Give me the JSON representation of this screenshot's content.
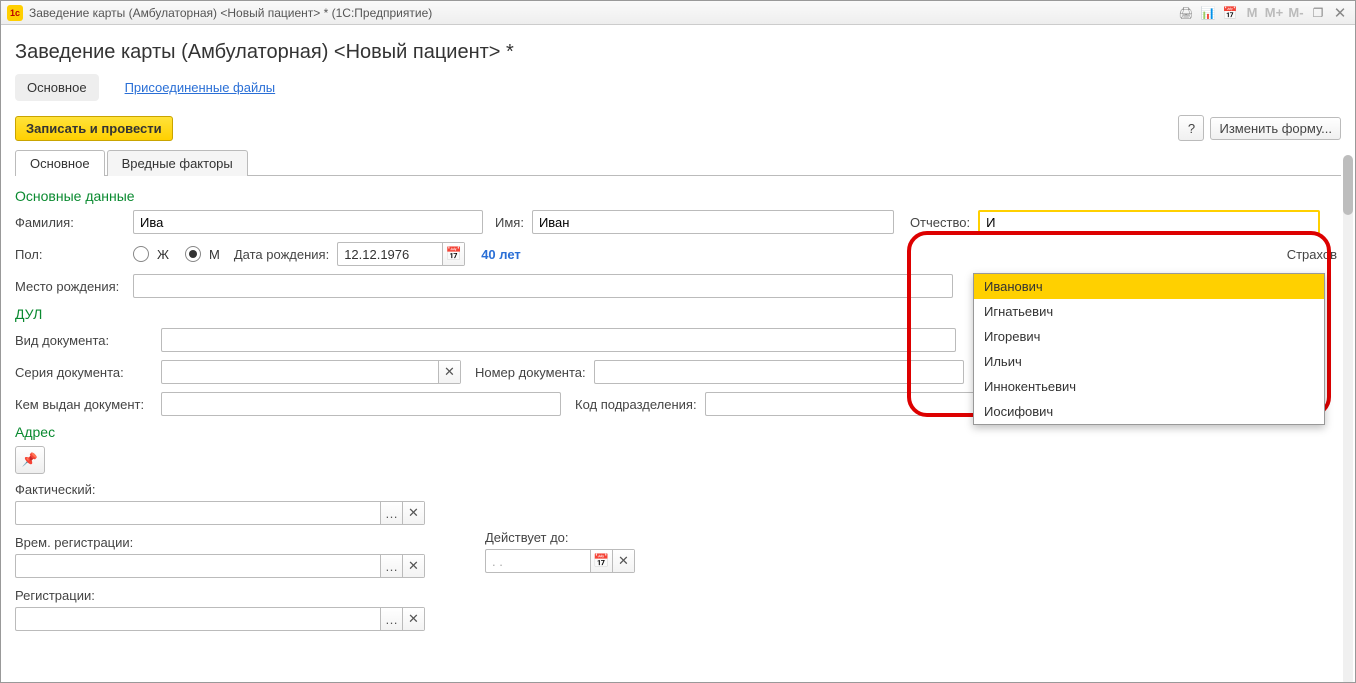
{
  "window_title": "Заведение карты (Амбулаторная) <Новый пациент> *  (1С:Предприятие)",
  "page_header": "Заведение карты (Амбулаторная) <Новый пациент> *",
  "nav": {
    "main": "Основное",
    "files": "Присоединенные файлы"
  },
  "toolbar": {
    "save": "Записать и провести",
    "help": "?",
    "change_form": "Изменить форму..."
  },
  "tabs": {
    "main": "Основное",
    "harmful": "Вредные факторы"
  },
  "sections": {
    "basic": "Основные данные",
    "dul": "ДУЛ",
    "address": "Адрес"
  },
  "labels": {
    "surname": "Фамилия:",
    "name": "Имя:",
    "patronymic": "Отчество:",
    "sex": "Пол:",
    "sex_f": "Ж",
    "sex_m": "М",
    "dob": "Дата рождения:",
    "age": "40 лет",
    "insurance": "Страхов",
    "birthplace": "Место рождения:",
    "doc_type": "Вид документа:",
    "doc_series": "Серия документа:",
    "doc_number": "Номер документа:",
    "doc_issuer": "Кем выдан документ:",
    "dept_code": "Код подразделения:",
    "addr_actual": "Фактический:",
    "addr_temp": "Врем. регистрации:",
    "valid_until": "Действует до:",
    "addr_reg": "Регистрации:"
  },
  "values": {
    "surname": "Ива",
    "name": "Иван",
    "patronymic": "И",
    "dob": "12.12.1976",
    "valid_until_placeholder": "  .  .    "
  },
  "dropdown": {
    "options": [
      "Иванович",
      "Игнатьевич",
      "Игоревич",
      "Ильич",
      "Иннокентьевич",
      "Иосифович"
    ],
    "selected_index": 0
  },
  "memory_buttons": {
    "m": "M",
    "mp": "M+",
    "mm": "M-"
  }
}
